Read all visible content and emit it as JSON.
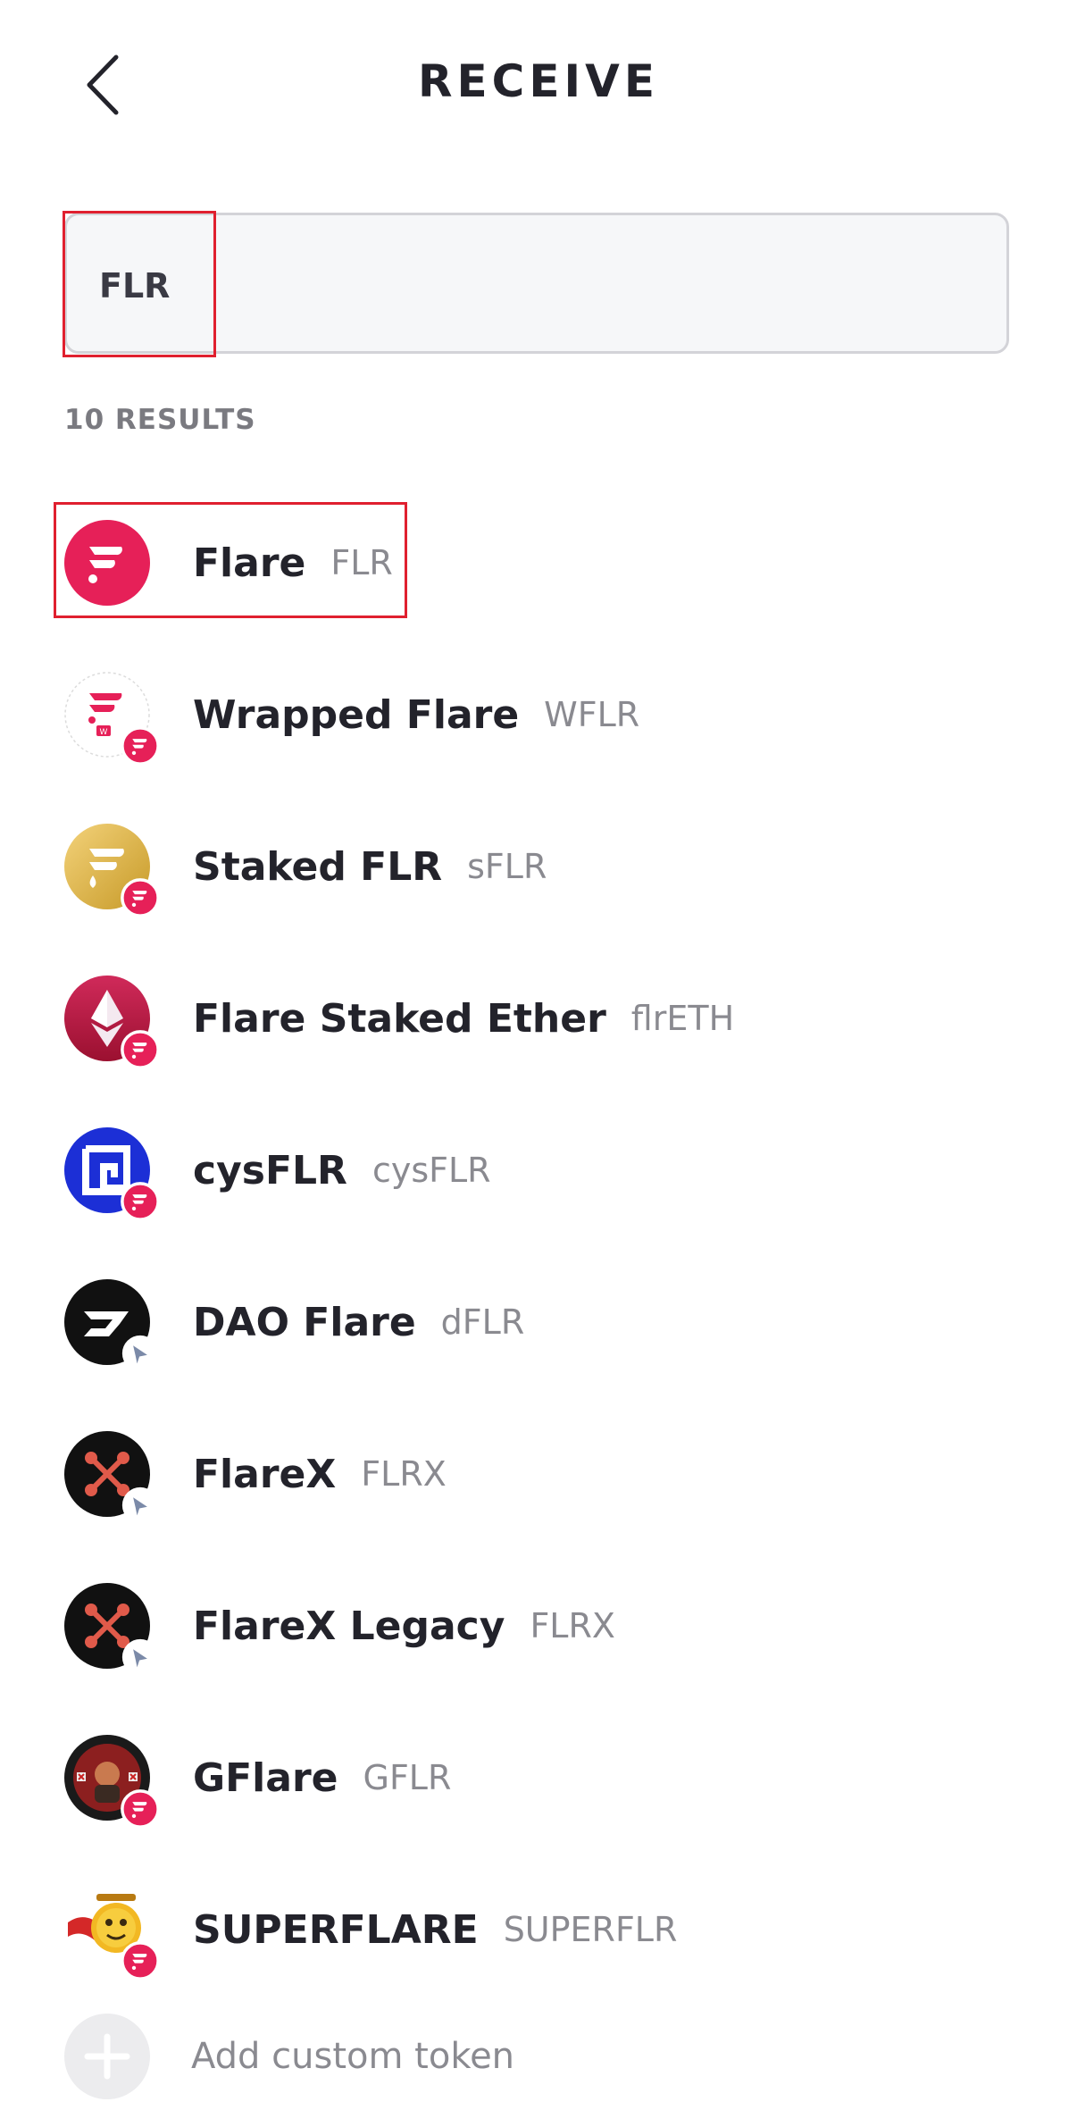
{
  "header": {
    "title": "RECEIVE",
    "back_icon": "chevron-left-icon"
  },
  "search": {
    "value": "FLR",
    "placeholder": ""
  },
  "results": {
    "label": "10 RESULTS"
  },
  "tokens": [
    {
      "name": "Flare",
      "symbol": "FLR",
      "icon": "flare-logo-icon",
      "badge": "none"
    },
    {
      "name": "Wrapped Flare",
      "symbol": "WFLR",
      "icon": "wrapped-flare-logo-icon",
      "badge": "flare-network-badge"
    },
    {
      "name": "Staked FLR",
      "symbol": "sFLR",
      "icon": "staked-flr-logo-icon",
      "badge": "flare-network-badge"
    },
    {
      "name": "Flare Staked Ether",
      "symbol": "flrETH",
      "icon": "flare-staked-ether-logo-icon",
      "badge": "flare-network-badge"
    },
    {
      "name": "cysFLR",
      "symbol": "cysFLR",
      "icon": "cysflr-logo-icon",
      "badge": "flare-network-badge"
    },
    {
      "name": "DAO Flare",
      "symbol": "dFLR",
      "icon": "dao-flare-logo-icon",
      "badge": "songbird-network-badge"
    },
    {
      "name": "FlareX",
      "symbol": "FLRX",
      "icon": "flarex-logo-icon",
      "badge": "songbird-network-badge"
    },
    {
      "name": "FlareX Legacy",
      "symbol": "FLRX",
      "icon": "flarex-logo-icon",
      "badge": "songbird-network-badge"
    },
    {
      "name": "GFlare",
      "symbol": "GFLR",
      "icon": "gflare-logo-icon",
      "badge": "flare-network-badge"
    },
    {
      "name": "SUPERFLARE",
      "symbol": "SUPERFLR",
      "icon": "superflare-logo-icon",
      "badge": "flare-network-badge"
    }
  ],
  "add_custom": {
    "label": "Add custom token",
    "icon": "plus-icon"
  },
  "colors": {
    "flare_pink": "#e62058",
    "highlight_red": "#e0202f",
    "text_dark": "#23232b",
    "text_muted": "#8a8a90"
  }
}
